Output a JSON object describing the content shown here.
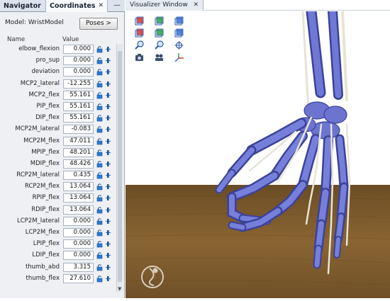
{
  "navigator_tab": "Navigator",
  "coordinates_tab": "Coordinates",
  "close_glyph": "✕",
  "minimize_glyph": "—",
  "model_label": "Model: WristModel",
  "poses_button": "Poses >",
  "header_name": "Name",
  "header_value": "Value",
  "coordinates": [
    {
      "name": "elbow_flexion",
      "value": "0.000"
    },
    {
      "name": "pro_sup",
      "value": "0.000"
    },
    {
      "name": "deviation",
      "value": "0.000"
    },
    {
      "name": "MCP2_lateral",
      "value": "-12.255"
    },
    {
      "name": "MCP2_flex",
      "value": "55.161"
    },
    {
      "name": "PIP_flex",
      "value": "55.161"
    },
    {
      "name": "DIP_flex",
      "value": "55.161"
    },
    {
      "name": "MCP2M_lateral",
      "value": "-0.083"
    },
    {
      "name": "MCP2M_flex",
      "value": "47.011"
    },
    {
      "name": "MPIP_flex",
      "value": "48.201"
    },
    {
      "name": "MDIP_flex",
      "value": "48.426"
    },
    {
      "name": "RCP2M_lateral",
      "value": "0.435"
    },
    {
      "name": "RCP2M_flex",
      "value": "13.064"
    },
    {
      "name": "RPIP_flex",
      "value": "13.064"
    },
    {
      "name": "RDIP_flex",
      "value": "13.064"
    },
    {
      "name": "LCP2M_lateral",
      "value": "0.000"
    },
    {
      "name": "LCP2M_flex",
      "value": "0.000"
    },
    {
      "name": "LPIP_flex",
      "value": "0.000"
    },
    {
      "name": "LDIP_flex",
      "value": "0.000"
    },
    {
      "name": "thumb_abd",
      "value": "3.315"
    },
    {
      "name": "thumb_flex",
      "value": "27.610"
    }
  ],
  "visualizer_tab": "Visualizer Window",
  "toolbar_icons": [
    "view-front-icon",
    "view-top-icon",
    "view-right-icon",
    "view-back-icon",
    "view-bottom-icon",
    "view-left-icon",
    "zoom-in-icon",
    "zoom-out-icon",
    "fit-view-icon",
    "snapshot-icon",
    "record-icon",
    "axes-icon"
  ],
  "colors": {
    "bone": "#6f77d2",
    "bone_dark": "#3c4194",
    "tendon": "#e7e4d6",
    "floor": "#7a5a2d",
    "accent": "#2a7bd8"
  }
}
